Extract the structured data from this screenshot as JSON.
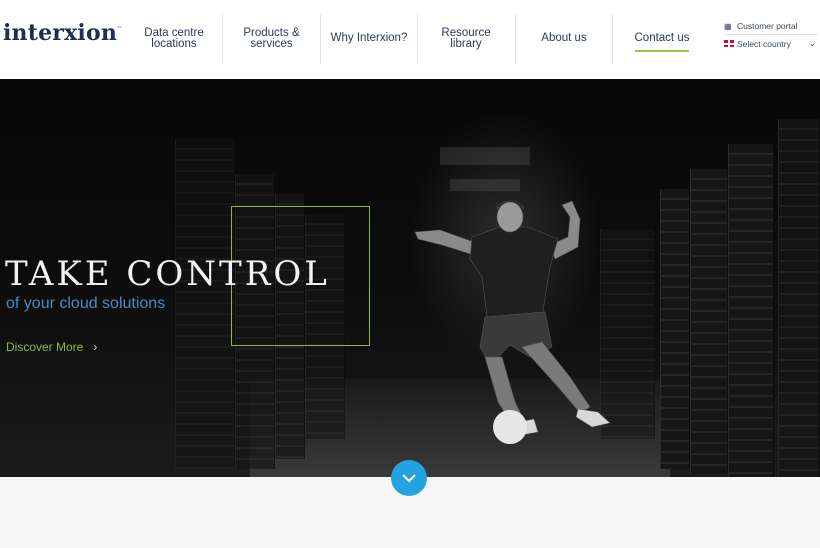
{
  "header": {
    "logo": "interxion",
    "logo_mark": "™",
    "nav": [
      {
        "label": "Data centre locations"
      },
      {
        "label": "Products & services"
      },
      {
        "label": "Why Interxion?"
      },
      {
        "label": "Resource library"
      },
      {
        "label": "About us"
      },
      {
        "label": "Contact us",
        "active": true
      }
    ],
    "utility": {
      "customer_portal": "Customer portal",
      "customer_portal_icon": "portal-icon",
      "select_country": "Select country",
      "country_flag": "uk-flag-icon",
      "dropdown_icon": "chevron-down-icon"
    }
  },
  "hero": {
    "title": "TAKE CONTROL",
    "subtitle": "of your cloud solutions",
    "cta_label": "Discover More",
    "cta_icon": "chevron-right-icon",
    "image_description": "Footballer kicking a ball in a dark data centre aisle lined with server racks"
  },
  "scroll_button": {
    "icon": "chevron-down-icon"
  },
  "colors": {
    "brand_navy": "#1e2e56",
    "accent_green": "#8db84a",
    "accent_blue_text": "#4a8ac6",
    "scroll_button": "#23a3e0",
    "active_underline": "#9dc34a"
  }
}
